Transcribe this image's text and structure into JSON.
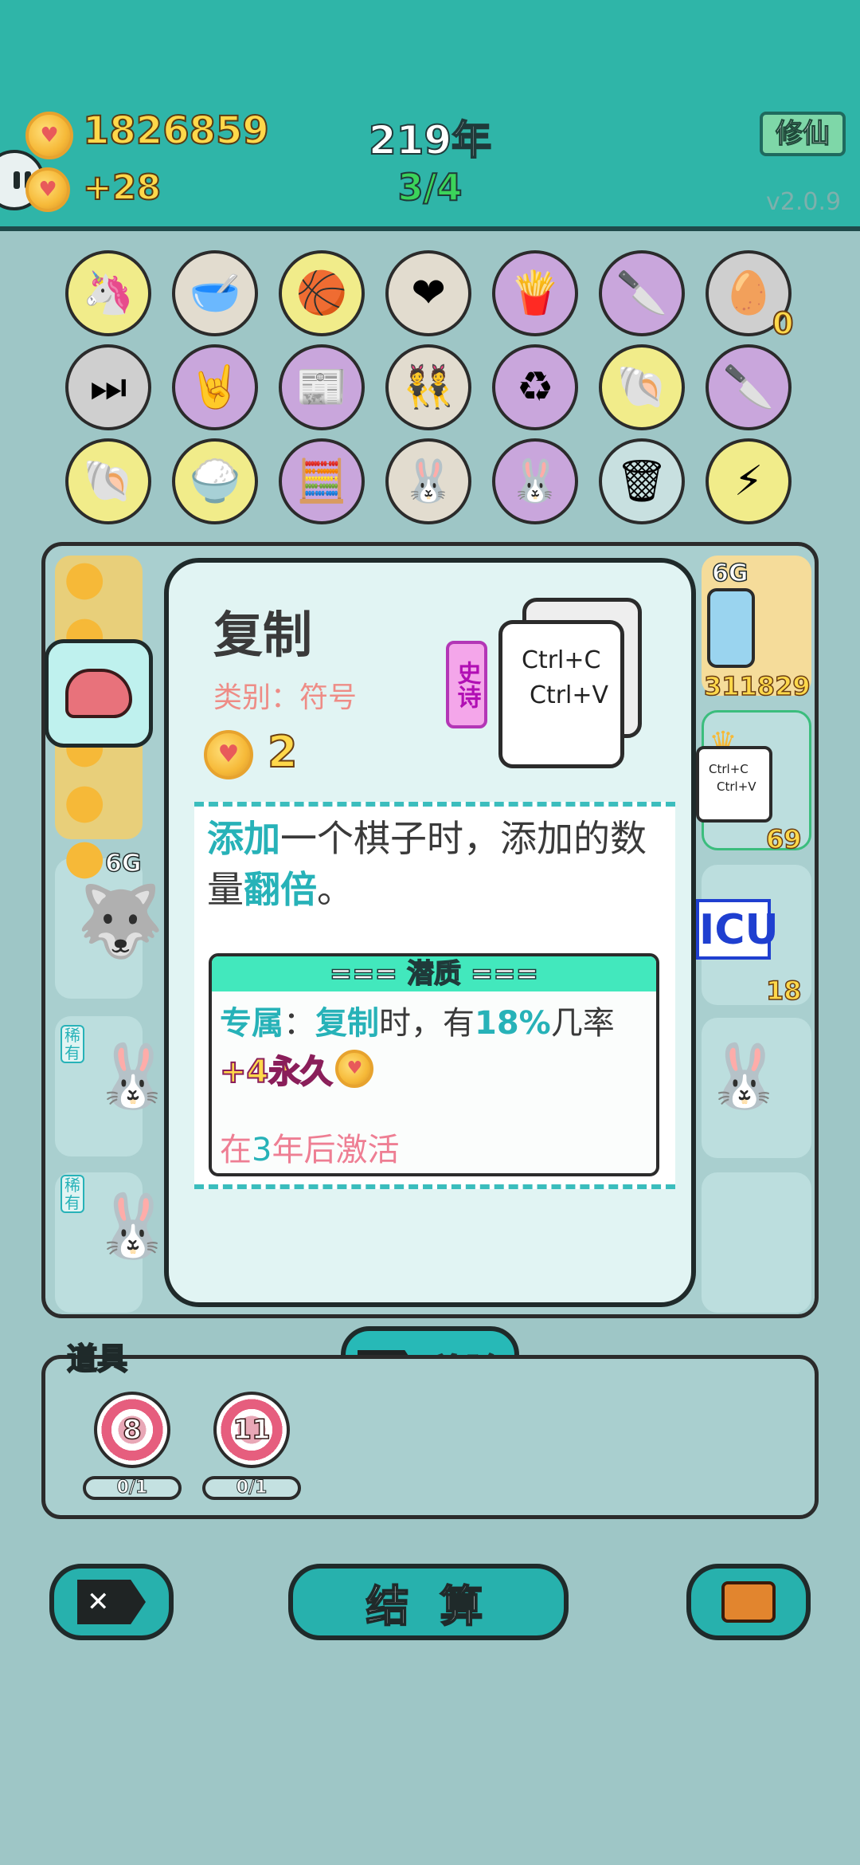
{
  "header": {
    "coins": "1826859",
    "income": "+28",
    "year": "219年",
    "round": "3/4",
    "mode_button": "修仙",
    "version": "v2.0.9"
  },
  "board": {
    "row1": [
      "unicorn",
      "pet-food-bowl",
      "basketballs",
      "heart-fan",
      "french-fries",
      "cleaver",
      "egg-tray"
    ],
    "row2": [
      "skip-next",
      "rock-hand",
      "time-magazine",
      "twins",
      "recycle",
      "seashell",
      "cleaver"
    ],
    "row3": [
      "seashell",
      "rice-bowl",
      "math-person",
      "bunny",
      "bunny",
      "trash-bag",
      "lightning"
    ],
    "egg_tray_count": "0",
    "side_left_label": "6G",
    "side_right_label": "6G",
    "side_right_value": "311829",
    "side_right_copy_count": "69",
    "icu_label": "ICU",
    "icu_count": "18",
    "rare_tag": "稀有",
    "copy_card_small": [
      "Ctrl+C",
      "Ctrl+V"
    ]
  },
  "popup": {
    "title": "复制",
    "category": "类别：符号",
    "cost": "2",
    "rarity": "史诗",
    "card_text": [
      "Ctrl+C",
      "Ctrl+V"
    ],
    "desc_hl1": "添加",
    "desc_mid": "一个棋子时，添加的数量",
    "desc_hl2": "翻倍",
    "desc_end": "。",
    "potential_title": "=== 潜质 ===",
    "pot_hl1": "专属",
    "pot_colon": "：",
    "pot_hl2": "复制",
    "pot_mid": "时，有",
    "pot_hl3": "18%",
    "pot_end": "几率",
    "pot_bonus": "+4永久",
    "activation_prefix": "在",
    "activation_num": "3",
    "activation_suffix": "年后激活"
  },
  "remove_button": "移除",
  "items": {
    "label": "道具",
    "list": [
      {
        "value": "8",
        "usage": "0/1"
      },
      {
        "value": "11",
        "usage": "0/1"
      }
    ]
  },
  "bottom": {
    "settle": "结 算"
  },
  "colors": {
    "header": "#2fb5a8",
    "accent": "#27b2b8",
    "coin": "#ffd84a",
    "epic": "#b10eb4"
  }
}
